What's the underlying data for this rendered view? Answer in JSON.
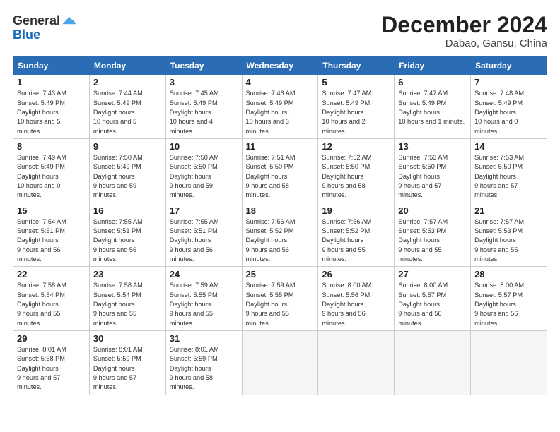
{
  "logo": {
    "general": "General",
    "blue": "Blue"
  },
  "title": "December 2024",
  "location": "Dabao, Gansu, China",
  "days_header": [
    "Sunday",
    "Monday",
    "Tuesday",
    "Wednesday",
    "Thursday",
    "Friday",
    "Saturday"
  ],
  "weeks": [
    [
      {
        "day": "1",
        "sunrise": "7:43 AM",
        "sunset": "5:49 PM",
        "daylight": "10 hours and 5 minutes."
      },
      {
        "day": "2",
        "sunrise": "7:44 AM",
        "sunset": "5:49 PM",
        "daylight": "10 hours and 5 minutes."
      },
      {
        "day": "3",
        "sunrise": "7:45 AM",
        "sunset": "5:49 PM",
        "daylight": "10 hours and 4 minutes."
      },
      {
        "day": "4",
        "sunrise": "7:46 AM",
        "sunset": "5:49 PM",
        "daylight": "10 hours and 3 minutes."
      },
      {
        "day": "5",
        "sunrise": "7:47 AM",
        "sunset": "5:49 PM",
        "daylight": "10 hours and 2 minutes."
      },
      {
        "day": "6",
        "sunrise": "7:47 AM",
        "sunset": "5:49 PM",
        "daylight": "10 hours and 1 minute."
      },
      {
        "day": "7",
        "sunrise": "7:48 AM",
        "sunset": "5:49 PM",
        "daylight": "10 hours and 0 minutes."
      }
    ],
    [
      {
        "day": "8",
        "sunrise": "7:49 AM",
        "sunset": "5:49 PM",
        "daylight": "10 hours and 0 minutes."
      },
      {
        "day": "9",
        "sunrise": "7:50 AM",
        "sunset": "5:49 PM",
        "daylight": "9 hours and 59 minutes."
      },
      {
        "day": "10",
        "sunrise": "7:50 AM",
        "sunset": "5:50 PM",
        "daylight": "9 hours and 59 minutes."
      },
      {
        "day": "11",
        "sunrise": "7:51 AM",
        "sunset": "5:50 PM",
        "daylight": "9 hours and 58 minutes."
      },
      {
        "day": "12",
        "sunrise": "7:52 AM",
        "sunset": "5:50 PM",
        "daylight": "9 hours and 58 minutes."
      },
      {
        "day": "13",
        "sunrise": "7:53 AM",
        "sunset": "5:50 PM",
        "daylight": "9 hours and 57 minutes."
      },
      {
        "day": "14",
        "sunrise": "7:53 AM",
        "sunset": "5:50 PM",
        "daylight": "9 hours and 57 minutes."
      }
    ],
    [
      {
        "day": "15",
        "sunrise": "7:54 AM",
        "sunset": "5:51 PM",
        "daylight": "9 hours and 56 minutes."
      },
      {
        "day": "16",
        "sunrise": "7:55 AM",
        "sunset": "5:51 PM",
        "daylight": "9 hours and 56 minutes."
      },
      {
        "day": "17",
        "sunrise": "7:55 AM",
        "sunset": "5:51 PM",
        "daylight": "9 hours and 56 minutes."
      },
      {
        "day": "18",
        "sunrise": "7:56 AM",
        "sunset": "5:52 PM",
        "daylight": "9 hours and 56 minutes."
      },
      {
        "day": "19",
        "sunrise": "7:56 AM",
        "sunset": "5:52 PM",
        "daylight": "9 hours and 55 minutes."
      },
      {
        "day": "20",
        "sunrise": "7:57 AM",
        "sunset": "5:53 PM",
        "daylight": "9 hours and 55 minutes."
      },
      {
        "day": "21",
        "sunrise": "7:57 AM",
        "sunset": "5:53 PM",
        "daylight": "9 hours and 55 minutes."
      }
    ],
    [
      {
        "day": "22",
        "sunrise": "7:58 AM",
        "sunset": "5:54 PM",
        "daylight": "9 hours and 55 minutes."
      },
      {
        "day": "23",
        "sunrise": "7:58 AM",
        "sunset": "5:54 PM",
        "daylight": "9 hours and 55 minutes."
      },
      {
        "day": "24",
        "sunrise": "7:59 AM",
        "sunset": "5:55 PM",
        "daylight": "9 hours and 55 minutes."
      },
      {
        "day": "25",
        "sunrise": "7:59 AM",
        "sunset": "5:55 PM",
        "daylight": "9 hours and 55 minutes."
      },
      {
        "day": "26",
        "sunrise": "8:00 AM",
        "sunset": "5:56 PM",
        "daylight": "9 hours and 56 minutes."
      },
      {
        "day": "27",
        "sunrise": "8:00 AM",
        "sunset": "5:57 PM",
        "daylight": "9 hours and 56 minutes."
      },
      {
        "day": "28",
        "sunrise": "8:00 AM",
        "sunset": "5:57 PM",
        "daylight": "9 hours and 56 minutes."
      }
    ],
    [
      {
        "day": "29",
        "sunrise": "8:01 AM",
        "sunset": "5:58 PM",
        "daylight": "9 hours and 57 minutes."
      },
      {
        "day": "30",
        "sunrise": "8:01 AM",
        "sunset": "5:59 PM",
        "daylight": "9 hours and 57 minutes."
      },
      {
        "day": "31",
        "sunrise": "8:01 AM",
        "sunset": "5:59 PM",
        "daylight": "9 hours and 58 minutes."
      },
      null,
      null,
      null,
      null
    ]
  ]
}
